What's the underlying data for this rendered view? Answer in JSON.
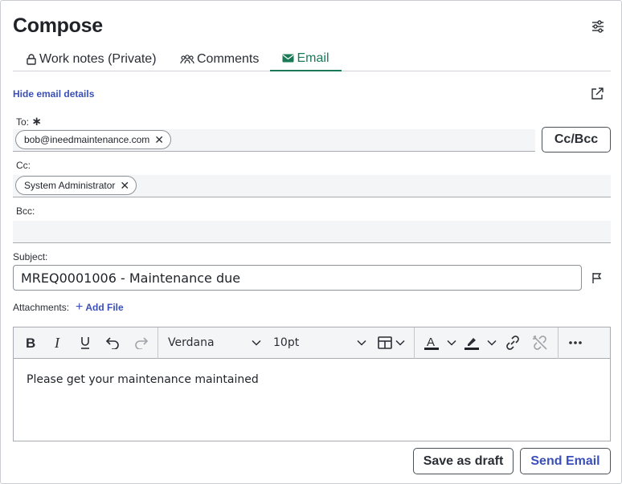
{
  "header": {
    "title": "Compose",
    "settings_icon": "sliders-icon"
  },
  "tabs": [
    {
      "label": "Work notes (Private)",
      "icon": "lock-icon",
      "active": false
    },
    {
      "label": "Comments",
      "icon": "people-icon",
      "active": false
    },
    {
      "label": "Email",
      "icon": "envelope-icon",
      "active": true
    }
  ],
  "email_details": {
    "toggle_label": "Hide email details",
    "popout_icon": "external-link-icon"
  },
  "to": {
    "label": "To:",
    "required_marker": "∗",
    "chips": [
      "bob@ineedmaintenance.com"
    ]
  },
  "cc_bcc_button": "Cc/Bcc",
  "cc": {
    "label": "Cc:",
    "chips": [
      "System Administrator"
    ]
  },
  "bcc": {
    "label": "Bcc:",
    "chips": []
  },
  "subject": {
    "label": "Subject:",
    "value": "MREQ0001006 - Maintenance due",
    "flag_icon": "flag-icon"
  },
  "attachments": {
    "label": "Attachments:",
    "add_label": "Add File"
  },
  "editor": {
    "font_family": "Verdana",
    "font_size": "10pt",
    "body": "Please get your maintenance maintained",
    "tools": [
      "bold",
      "italic",
      "underline",
      "undo",
      "redo",
      "table",
      "text-color",
      "highlight",
      "link",
      "unlink",
      "more"
    ]
  },
  "actions": {
    "save_draft": "Save as draft",
    "send": "Send Email"
  },
  "colors": {
    "accent_green": "#1a7a57",
    "link_blue": "#3b4fb8",
    "field_bg": "#f4f5f7"
  }
}
